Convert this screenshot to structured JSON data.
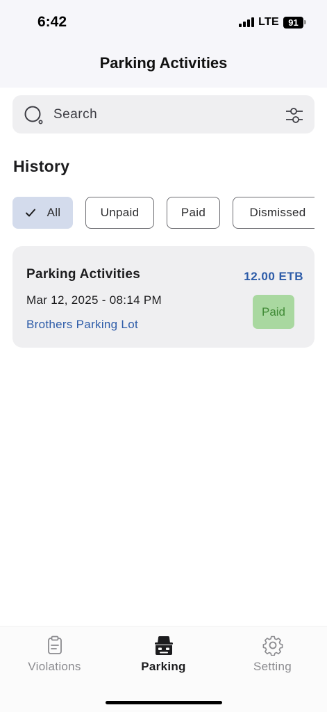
{
  "status_bar": {
    "time": "6:42",
    "network": "LTE",
    "battery": "91"
  },
  "header": {
    "title": "Parking Activities"
  },
  "search": {
    "placeholder": "Search"
  },
  "history": {
    "title": "History",
    "filters": [
      {
        "label": "All",
        "selected": true
      },
      {
        "label": "Unpaid",
        "selected": false
      },
      {
        "label": "Paid",
        "selected": false
      },
      {
        "label": "Dismissed",
        "selected": false
      }
    ]
  },
  "activities": [
    {
      "title": "Parking Activities",
      "amount": "12.00 ETB",
      "datetime": "Mar 12, 2025 - 08:14 PM",
      "location": "Brothers Parking Lot",
      "status": "Paid"
    }
  ],
  "tabs": [
    {
      "label": "Violations",
      "icon": "clipboard-icon",
      "active": false
    },
    {
      "label": "Parking",
      "icon": "car-icon",
      "active": true
    },
    {
      "label": "Setting",
      "icon": "gear-icon",
      "active": false
    }
  ],
  "colors": {
    "accent_blue": "#2c5ba8",
    "chip_selected_bg": "#d3dbec",
    "paid_badge_bg": "#a9d8a0",
    "paid_badge_text": "#3f8a35"
  }
}
